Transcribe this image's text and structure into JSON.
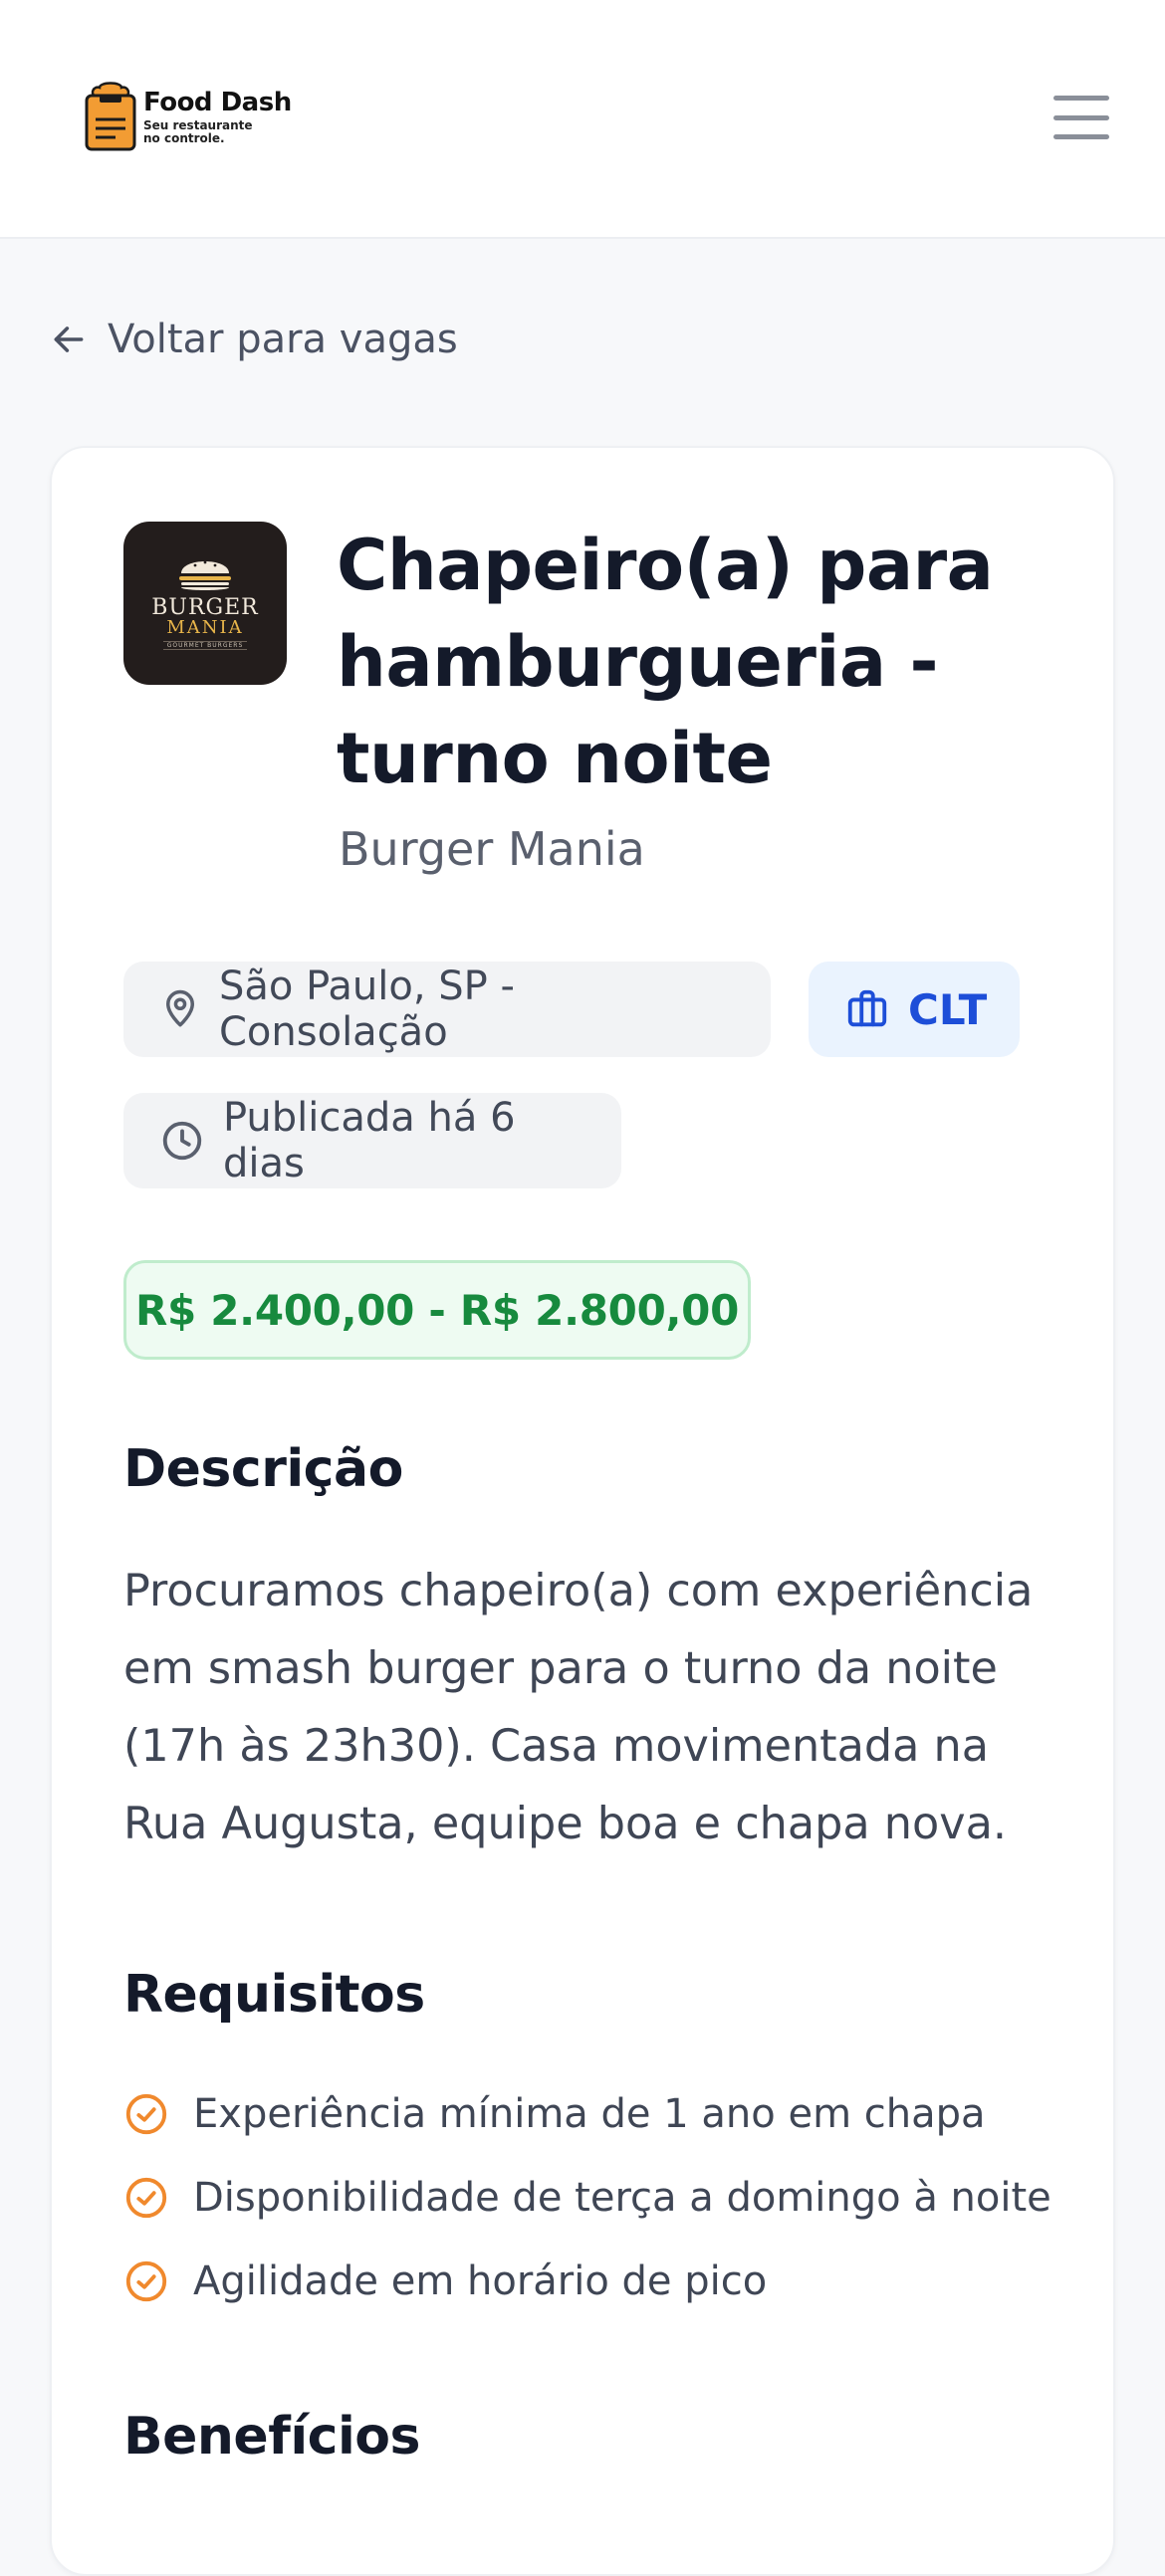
{
  "header": {
    "brand_name": "Food Dash",
    "brand_tagline": "Seu restaurante no controle.",
    "logo_icon": "chef-hat-clipboard-icon",
    "menu_icon": "hamburger-menu-icon"
  },
  "nav": {
    "back_label": "Voltar para vagas",
    "back_icon": "arrow-left-icon"
  },
  "job": {
    "title": "Chapeiro(a) para hamburgueria - turno noite",
    "company": "Burger Mania",
    "company_logo": {
      "line1": "BURGER",
      "line2": "MANIA",
      "line3": "GOURMET BURGERS"
    },
    "location": "São Paulo, SP - Consolação",
    "location_icon": "map-pin-icon",
    "contract_type": "CLT",
    "contract_icon": "briefcase-icon",
    "posted": "Publicada há 6 dias",
    "posted_icon": "clock-icon",
    "salary": "R$ 2.400,00 - R$ 2.800,00"
  },
  "description": {
    "title": "Descrição",
    "text": "Procuramos chapeiro(a) com experiência em smash burger para o turno da noite (17h às 23h30). Casa movimentada na Rua Augusta, equipe boa e chapa nova."
  },
  "requirements": {
    "title": "Requisitos",
    "icon": "check-circle-icon",
    "items": [
      "Experiência mínima de 1 ano em chapa",
      "Disponibilidade de terça a domingo à noite",
      "Agilidade em horário de pico"
    ]
  },
  "benefits": {
    "title": "Benefícios"
  },
  "colors": {
    "accent_orange": "#f0892d",
    "salary_green": "#178a3e",
    "chip_blue": "#1d4ed8"
  }
}
